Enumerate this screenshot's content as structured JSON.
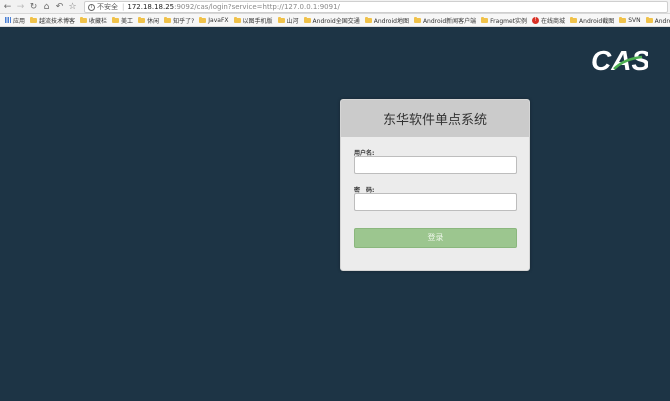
{
  "browser": {
    "security_label": "不安全",
    "url_host": "172.18.18.25",
    "url_rest": ":9092/cas/login?service=http://127.0.0.1:9091/"
  },
  "bookmarks": [
    {
      "label": "应用",
      "icon": "apps-icon"
    },
    {
      "label": "越流技术博客",
      "icon": "folder-icon"
    },
    {
      "label": "收藏栏",
      "icon": "folder-icon"
    },
    {
      "label": "美工",
      "icon": "folder-icon"
    },
    {
      "label": "休闲",
      "icon": "folder-icon"
    },
    {
      "label": "知乎了?",
      "icon": "folder-icon"
    },
    {
      "label": "JavaFX",
      "icon": "folder-icon"
    },
    {
      "label": "以图手机版",
      "icon": "folder-icon"
    },
    {
      "label": "山河",
      "icon": "folder-icon"
    },
    {
      "label": "Android全国交通",
      "icon": "folder-icon"
    },
    {
      "label": "Android地图",
      "icon": "folder-icon"
    },
    {
      "label": "Android新闻客户端",
      "icon": "folder-icon"
    },
    {
      "label": "Fragmet实例",
      "icon": "folder-icon"
    },
    {
      "label": "在线商城",
      "icon": "red-circle-icon"
    },
    {
      "label": "Android截图",
      "icon": "folder-icon"
    },
    {
      "label": "SVN",
      "icon": "folder-icon"
    },
    {
      "label": "Android购物",
      "icon": "folder-icon"
    }
  ],
  "logo": {
    "text": "CAS"
  },
  "login": {
    "title": "东华软件单点系统",
    "username_label": "用户名:",
    "password_label": "密　码:",
    "submit_label": "登录"
  },
  "colors": {
    "background": "#1d3445",
    "button": "#9cc68f",
    "header": "#cbcbcb"
  }
}
